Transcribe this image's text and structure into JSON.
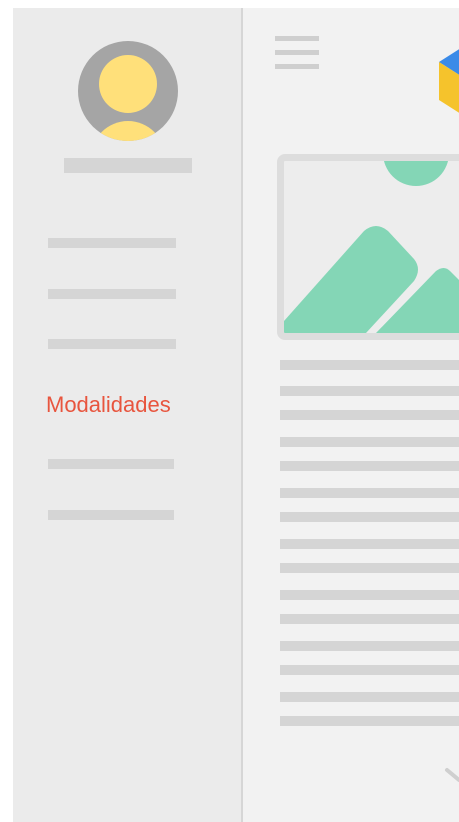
{
  "drawer": {
    "avatar_icon": "user-avatar-icon",
    "menu_items": [
      {
        "label": "",
        "placeholder": true
      },
      {
        "label": "",
        "placeholder": true
      },
      {
        "label": "",
        "placeholder": true
      },
      {
        "label": "Modalidades",
        "active": true
      },
      {
        "label": "",
        "placeholder": true
      },
      {
        "label": "",
        "placeholder": true
      }
    ]
  },
  "header": {
    "menu_icon": "hamburger-menu-icon",
    "logo_icon": "cube-logo-icon"
  },
  "content": {
    "image_icon": "landscape-image-icon",
    "scroll_icon": "chevron-down-icon"
  },
  "colors": {
    "accent": "#e8553e",
    "image_green": "#84d6b6",
    "avatar_yellow": "#ffe07a",
    "avatar_gray": "#a5a5a5",
    "placeholder": "#d5d5d5",
    "logo_blue": "#3b8be8",
    "logo_yellow": "#f5c32c"
  }
}
